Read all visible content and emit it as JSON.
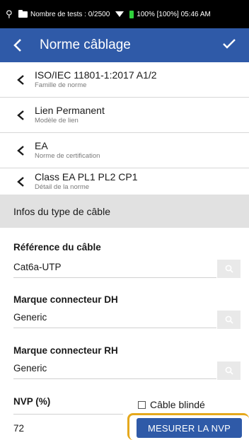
{
  "status_bar": {
    "tests_text": "Nombre de tests : 0/2500",
    "battery_text": "100% [100%] 05:46 AM",
    "battery_color": "#2fd13c"
  },
  "app_bar": {
    "title": "Norme câblage",
    "background": "#2f5aa8"
  },
  "selections": [
    {
      "value": "ISO/IEC 11801-1:2017 A1/2",
      "caption": "Famille de norme"
    },
    {
      "value": "Lien Permanent",
      "caption": "Modèle de lien"
    },
    {
      "value": "EA",
      "caption": "Norme de certification"
    },
    {
      "value": "Class EA PL1 PL2 CP1",
      "caption": "Détail de la norme"
    }
  ],
  "cable_section": {
    "header": "Infos du type de câble",
    "fields": [
      {
        "label": "Référence du câble",
        "value": "Cat6a-UTP"
      },
      {
        "label": "Marque connecteur DH",
        "value": "Generic"
      },
      {
        "label": "Marque connecteur RH",
        "value": "Generic"
      }
    ],
    "nvp": {
      "label": "NVP (%)",
      "value": "72",
      "shielded_label": "Câble blindé",
      "shielded_checked": false,
      "measure_button": "MESURER LA NVP"
    }
  },
  "highlight_color": "#e5a81c"
}
